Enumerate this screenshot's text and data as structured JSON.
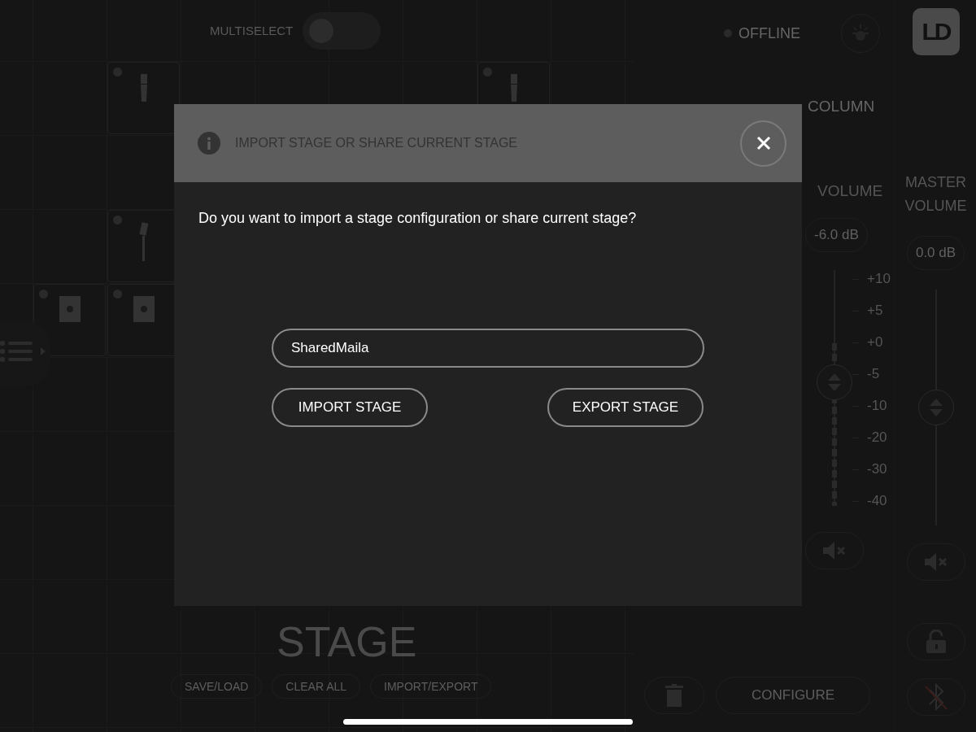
{
  "stage": {
    "multiselect": {
      "label": "MULTISELECT",
      "on": false
    },
    "cards": [
      {
        "kind": "column"
      },
      {
        "kind": "column"
      },
      {
        "kind": "satellite"
      },
      {
        "kind": "sub"
      },
      {
        "kind": "sub"
      }
    ],
    "title": "STAGE",
    "buttons": [
      "SAVE/LOAD",
      "CLEAR ALL",
      "IMPORT/EXPORT"
    ]
  },
  "panel": {
    "status": {
      "label": "OFFLINE",
      "online": false
    },
    "section_title": "COLUMN",
    "volume": {
      "label": "VOLUME",
      "reading": "-6.0 dB",
      "level": 0.53,
      "scale": [
        "+10",
        "+5",
        "+0",
        "-5",
        "-10",
        "-20",
        "-30",
        "-40"
      ]
    },
    "configure_button": "CONFIGURE"
  },
  "master": {
    "logo": "LD",
    "label": "MASTER VOLUME",
    "reading": "0.0 dB",
    "level": 0.5
  },
  "dialog": {
    "title": "IMPORT STAGE OR SHARE CURRENT STAGE",
    "message": "Do you want to import a stage configuration or share current stage?",
    "field": {
      "value": "SharedMaila"
    },
    "buttons": [
      "IMPORT STAGE",
      "EXPORT STAGE"
    ]
  }
}
